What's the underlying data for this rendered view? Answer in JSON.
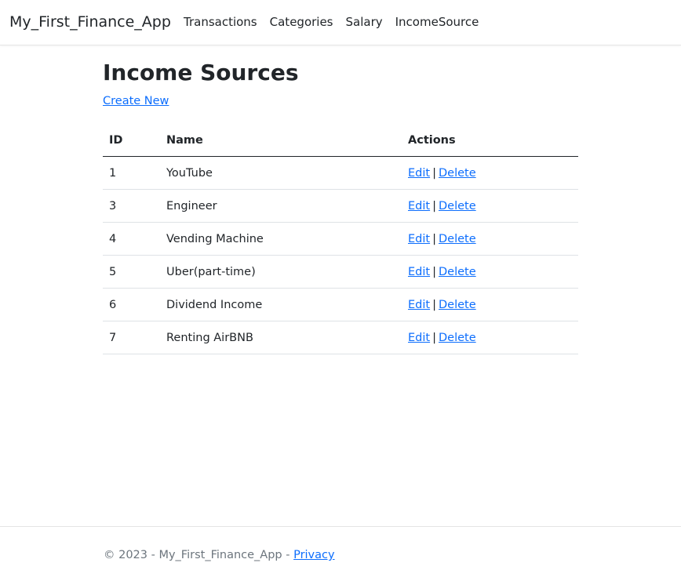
{
  "navbar": {
    "brand": "My_First_Finance_App",
    "links": [
      "Transactions",
      "Categories",
      "Salary",
      "IncomeSource"
    ]
  },
  "main": {
    "title": "Income Sources",
    "create_link": "Create New",
    "table": {
      "headers": [
        "ID",
        "Name",
        "Actions"
      ],
      "rows": [
        {
          "id": "1",
          "name": "YouTube"
        },
        {
          "id": "3",
          "name": "Engineer"
        },
        {
          "id": "4",
          "name": "Vending Machine"
        },
        {
          "id": "5",
          "name": "Uber(part-time)"
        },
        {
          "id": "6",
          "name": "Dividend Income"
        },
        {
          "id": "7",
          "name": "Renting AirBNB"
        }
      ],
      "edit_label": "Edit",
      "separator": "|",
      "delete_label": "Delete"
    }
  },
  "footer": {
    "text": "© 2023 - My_First_Finance_App - ",
    "privacy_link": "Privacy"
  },
  "colors": {
    "link": "#0d6efd",
    "text": "#212529",
    "muted": "#6c757d"
  }
}
